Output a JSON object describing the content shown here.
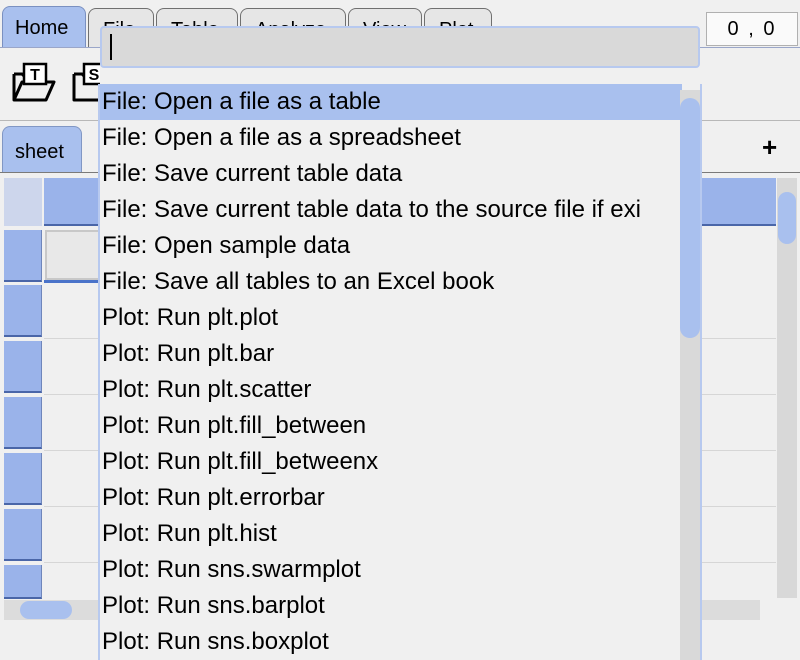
{
  "ribbon": {
    "tabs": [
      {
        "label": "Home",
        "active": true
      },
      {
        "label": "File",
        "active": false
      },
      {
        "label": "Table",
        "active": false
      },
      {
        "label": "Analyze",
        "active": false
      },
      {
        "label": "View",
        "active": false
      },
      {
        "label": "Plot",
        "active": false
      }
    ]
  },
  "position_display": "0 , 0",
  "toolbar": {
    "icons": [
      "open-table-icon",
      "open-spreadsheet-icon",
      "github-icon",
      "undo-redo-icon",
      "python-icon",
      "gamepad-icon",
      "settings-icon"
    ]
  },
  "sheet_tabs": [
    {
      "label": "sheet"
    }
  ],
  "add_tab_label": "+",
  "command_palette": {
    "input_value": "",
    "items": [
      {
        "label": "File: Open a file as a table",
        "highlighted": true
      },
      {
        "label": "File: Open a file as a spreadsheet",
        "highlighted": false
      },
      {
        "label": "File: Save current table data",
        "highlighted": false
      },
      {
        "label": "File: Save current table data to the source file if exi",
        "highlighted": false
      },
      {
        "label": "File: Open sample data",
        "highlighted": false
      },
      {
        "label": "File: Save all tables to an Excel book",
        "highlighted": false
      },
      {
        "label": "Plot: Run plt.plot",
        "highlighted": false
      },
      {
        "label": "Plot: Run plt.bar",
        "highlighted": false
      },
      {
        "label": "Plot: Run plt.scatter",
        "highlighted": false
      },
      {
        "label": "Plot: Run plt.fill_between",
        "highlighted": false
      },
      {
        "label": "Plot: Run plt.fill_betweenx",
        "highlighted": false
      },
      {
        "label": "Plot: Run plt.errorbar",
        "highlighted": false
      },
      {
        "label": "Plot: Run plt.hist",
        "highlighted": false
      },
      {
        "label": "Plot: Run sns.swarmplot",
        "highlighted": false
      },
      {
        "label": "Plot: Run sns.barplot",
        "highlighted": false
      },
      {
        "label": "Plot: Run sns.boxplot",
        "highlighted": false
      }
    ]
  },
  "colors": {
    "accent": "#a9c0ee",
    "header": "#9ab3ea",
    "selection": "#4a73c9"
  }
}
